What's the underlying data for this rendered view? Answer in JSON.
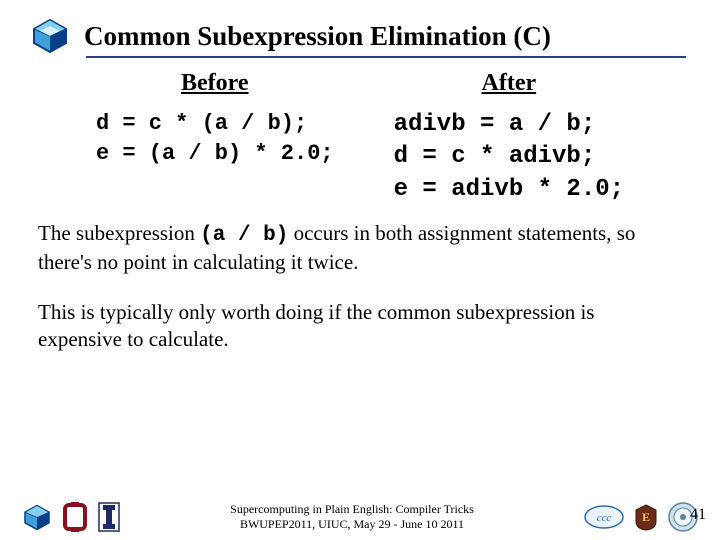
{
  "title": "Common Subexpression Elimination (C)",
  "columns": {
    "before": {
      "header": "Before",
      "code": "d = c * (a / b);\ne = (a / b) * 2.0;"
    },
    "after": {
      "header": "After",
      "code": "adivb = a / b;\nd = c * adivb;\ne = adivb * 2.0;"
    }
  },
  "paragraph1_a": "The subexpression ",
  "paragraph1_mono": "(a / b)",
  "paragraph1_b": " occurs in both assignment statements, so there's no point in calculating it twice.",
  "paragraph2": "This is typically only worth doing if the common subexpression is expensive to calculate.",
  "footer": {
    "line1": "Supercomputing in Plain English: Compiler Tricks",
    "line2": "BWUPEP2011, UIUC, May 29 - June 10 2011"
  },
  "page_number": "41",
  "icons": {
    "title_gem": "gem-icon",
    "footer_gem": "gem-icon",
    "ou_logo": "ou-logo",
    "uiuc_logo": "uiuc-logo",
    "ccc_logo": "ccc-logo",
    "bc_logo": "bc-logo",
    "seal_logo": "seal-logo"
  },
  "colors": {
    "rule": "#2b3f8b",
    "gem_outer": "#0a3f87",
    "gem_mid": "#3fa0d8",
    "ou_crimson": "#8a1020",
    "uiuc_blue": "#1f2a6b"
  }
}
